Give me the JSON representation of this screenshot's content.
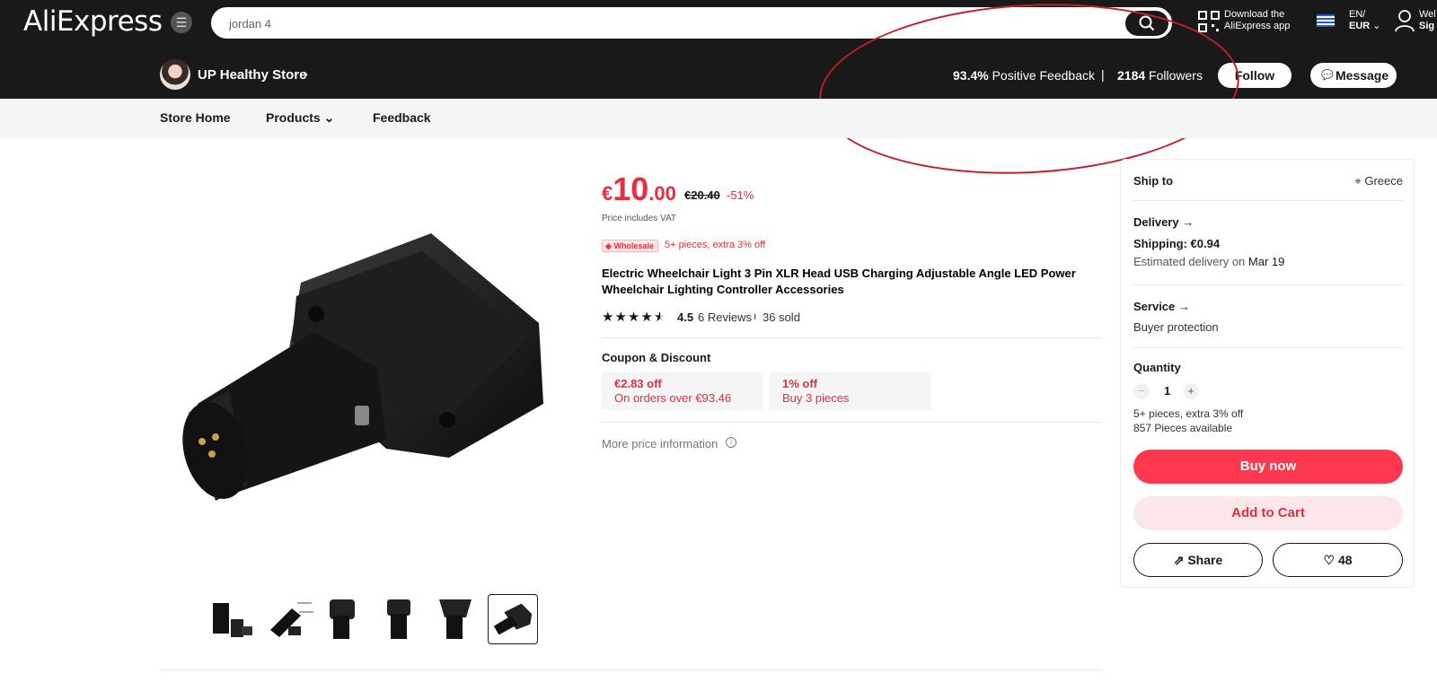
{
  "header": {
    "logo": "AliExpress",
    "search_value": "jordan 4",
    "download_line1": "Download the",
    "download_line2": "AliExpress app",
    "lang_line1": "EN/",
    "lang_line2": "EUR",
    "user_line1": "Wel",
    "user_line2": "Sig"
  },
  "store": {
    "name": "UP Healthy Store",
    "positive_pct": "93.4%",
    "positive_label": "Positive Feedback",
    "separator": "|",
    "followers_count": "2184",
    "followers_label": "Followers",
    "follow_label": "Follow",
    "message_label": "Message"
  },
  "store_nav": {
    "home": "Store Home",
    "products": "Products",
    "feedback": "Feedback"
  },
  "product": {
    "price_currency": "€",
    "price_int": "10",
    "price_dec": ".00",
    "price_old": "€20.40",
    "discount": "-51%",
    "vat_note": "Price includes VAT",
    "wholesale_badge": "Wholesale",
    "wholesale_text": "5+ pieces, extra 3% off",
    "title": "Electric Wheelchair Light 3 Pin XLR Head USB Charging Adjustable Angle LED Power Wheelchair Lighting Controller Accessories",
    "rating_value": 4.5,
    "rating": "4.5",
    "reviews": "6 Reviews",
    "sold": "36 sold",
    "coupon_heading": "Coupon & Discount",
    "coupons": [
      {
        "amount": "€2.83 off",
        "condition": "On orders over €93.46"
      },
      {
        "amount": "1% off",
        "condition": "Buy 3 pieces"
      }
    ],
    "more_price": "More price information",
    "thumbnail_count": 6,
    "active_thumbnail": 6
  },
  "panel": {
    "ship_to_label": "Ship to",
    "ship_to_value": "Greece",
    "delivery_label": "Delivery",
    "shipping": "Shipping: €0.94",
    "estimated_prefix": "Estimated delivery on",
    "estimated_date": "Mar 19",
    "service_label": "Service",
    "service_value": "Buyer protection",
    "quantity_label": "Quantity",
    "quantity_value": "1",
    "qty_minus": "−",
    "qty_plus": "+",
    "wholesale_note": "5+ pieces, extra 3% off",
    "available": "857 Pieces available",
    "buy_now": "Buy now",
    "add_to_cart": "Add to Cart",
    "share": "Share",
    "wishlist_count": "48"
  },
  "colors": {
    "brand_red": "#e62e3f",
    "buy_button": "#fd384f",
    "header_bg": "#191919",
    "annotation": "#c41e2a"
  },
  "icons": [
    "menu-icon",
    "search-icon",
    "qr-code-icon",
    "greek-flag-icon",
    "user-icon",
    "chevron-right-icon",
    "chevron-down-icon",
    "chat-bubble-icon",
    "star-icon",
    "info-icon",
    "location-pin-icon",
    "arrow-right-icon",
    "share-icon",
    "heart-icon"
  ]
}
